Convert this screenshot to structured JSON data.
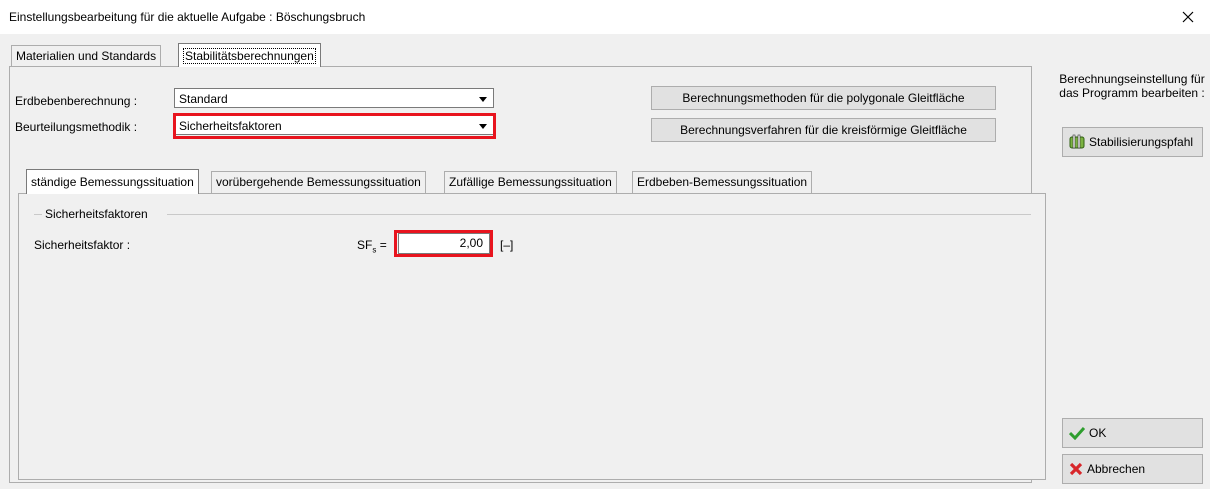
{
  "window": {
    "title": "Einstellungsbearbeitung für die aktuelle Aufgabe : Böschungsbruch",
    "close_icon": "×"
  },
  "outer_tabs": [
    {
      "label": "Materialien und Standards",
      "active": false
    },
    {
      "label": "Stabilitätsberechnungen",
      "active": true
    }
  ],
  "settings": {
    "earthquake_label": "Erdbebenberechnung :",
    "earthquake_value": "Standard",
    "method_label": "Beurteilungsmethodik :",
    "method_value": "Sicherheitsfaktoren"
  },
  "buttons": {
    "polygonal": "Berechnungsmethoden für die polygonale Gleitfläche",
    "circular": "Berechnungsverfahren für die kreisförmige Gleitfläche"
  },
  "inner_tabs": [
    {
      "label": "ständige Bemessungssituation",
      "active": true
    },
    {
      "label": "vorübergehende Bemessungssituation",
      "active": false
    },
    {
      "label": "Zufällige Bemessungssituation",
      "active": false
    },
    {
      "label": "Erdbeben-Bemessungssituation",
      "active": false
    }
  ],
  "group": {
    "title": "Sicherheitsfaktoren",
    "factor_label": "Sicherheitsfaktor :",
    "symbol": "SF",
    "symbol_sub": "s",
    "symbol_eq": "=",
    "value": "2,00",
    "unit": "[–]"
  },
  "side": {
    "description": "Berechnungseinstellung für das Programm bearbeiten :",
    "stabilization_button": "Stabilisierungspfahl",
    "ok_button": "OK",
    "cancel_button": "Abbrechen"
  },
  "colors": {
    "highlight": "#e8141e",
    "ok_check": "#2e9e2e",
    "cancel_x": "#d8262a"
  }
}
